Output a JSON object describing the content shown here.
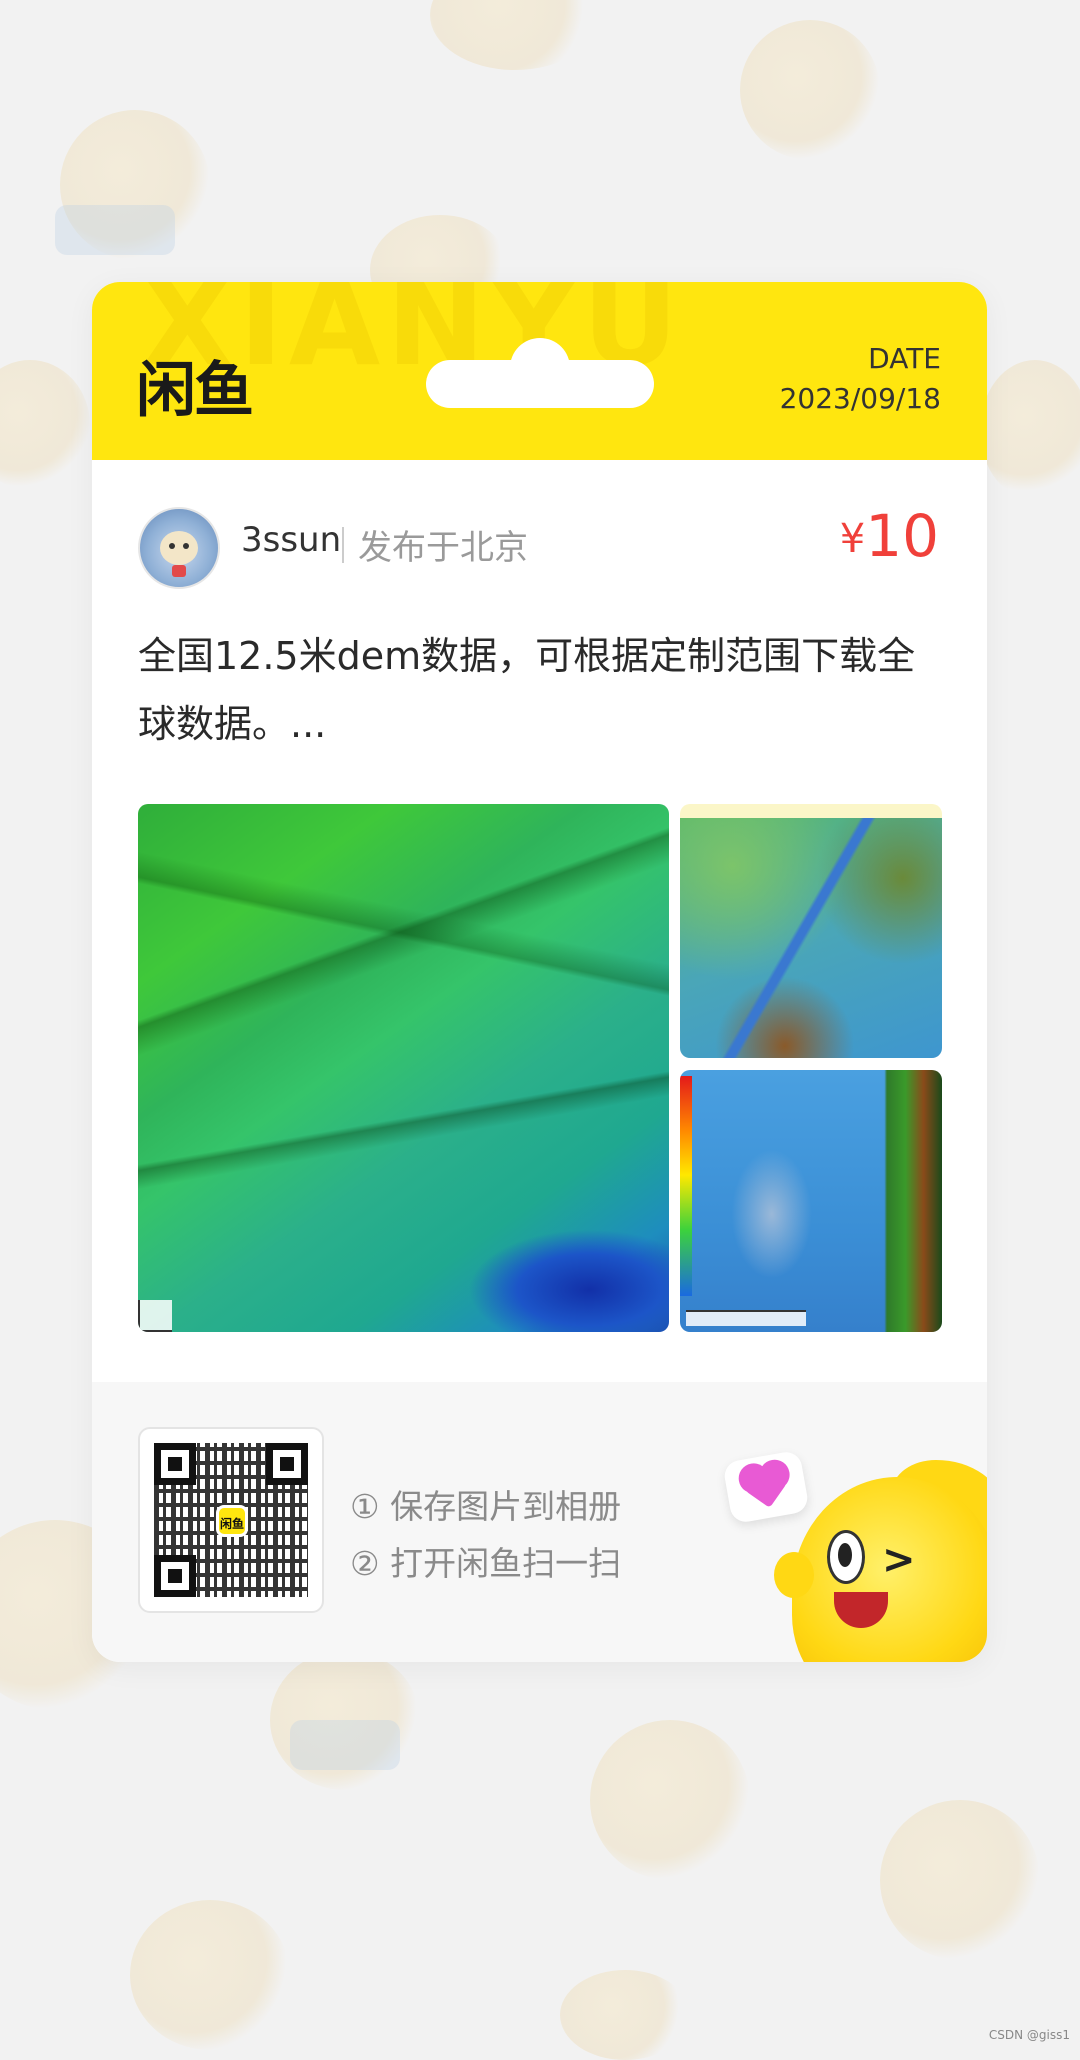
{
  "card": {
    "brand": "闲鱼",
    "watermark": "XIANYU",
    "date_label": "DATE",
    "date_value": "2023/09/18"
  },
  "seller": {
    "username": "3ssun",
    "location": "发布于北京"
  },
  "price": {
    "symbol": "¥",
    "value": "10"
  },
  "description": "全国12.5米dem数据，可根据定制范围下载全球数据。...",
  "images": [
    {
      "name": "dem-terrain-main"
    },
    {
      "name": "dem-river-top-right"
    },
    {
      "name": "dem-colormap-bottom-right"
    }
  ],
  "footer": {
    "qr_center_label": "闲鱼",
    "steps": [
      "① 保存图片到相册",
      "② 打开闲鱼扫一扫"
    ]
  },
  "credit": "CSDN @giss1",
  "colors": {
    "brand_yellow": "#ffe60f",
    "price_red": "#f0403a",
    "background": "#f2f2f2"
  }
}
